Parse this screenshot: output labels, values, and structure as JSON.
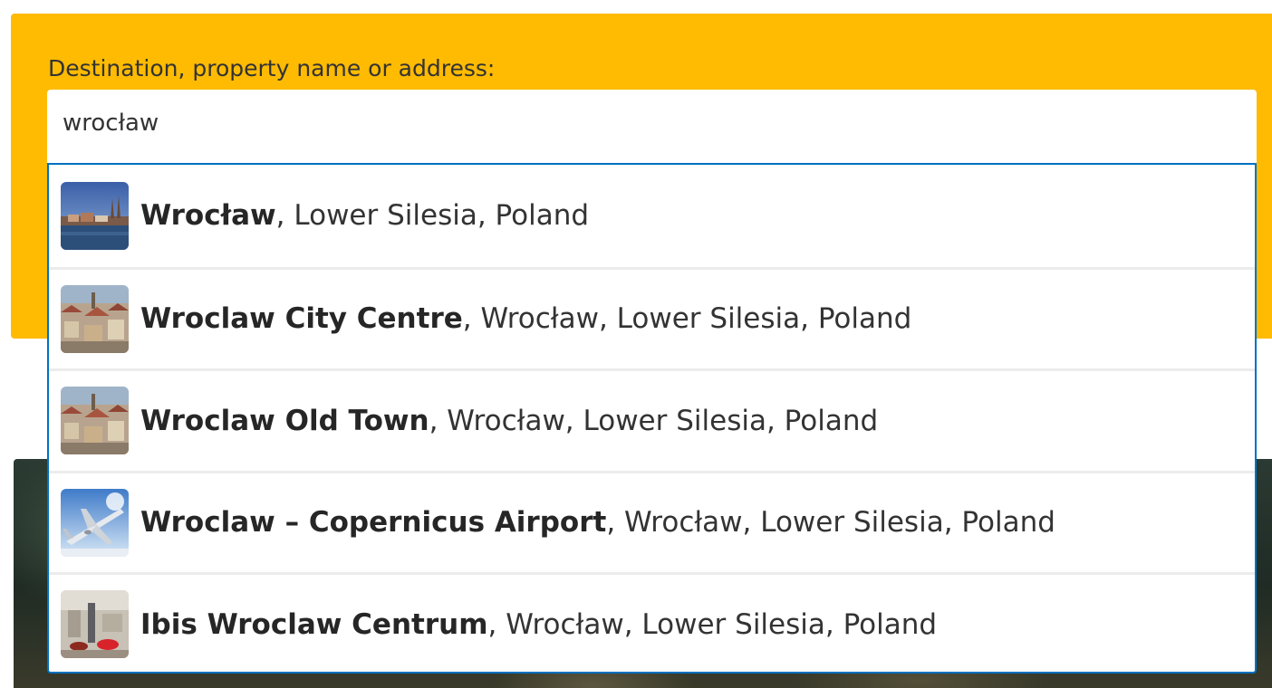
{
  "search": {
    "label": "Destination, property name or address:",
    "value": "wrocław"
  },
  "suggestions": [
    {
      "name": "Wrocław",
      "details": ", Lower Silesia, Poland",
      "thumb_icon": "city-panorama-photo"
    },
    {
      "name": "Wroclaw City Centre",
      "details": ", Wrocław, Lower Silesia, Poland",
      "thumb_icon": "city-rooftops-photo"
    },
    {
      "name": "Wroclaw Old Town",
      "details": ", Wrocław, Lower Silesia, Poland",
      "thumb_icon": "city-rooftops-photo"
    },
    {
      "name": "Wroclaw – Copernicus Airport",
      "details": ", Wrocław, Lower Silesia, Poland",
      "thumb_icon": "airplane-photo"
    },
    {
      "name": "Ibis Wroclaw Centrum",
      "details": ", Wrocław, Lower Silesia, Poland",
      "thumb_icon": "hotel-lobby-photo"
    }
  ],
  "colors": {
    "panel_background": "#febb02",
    "dropdown_border": "#0071c2",
    "text": "#333333"
  }
}
